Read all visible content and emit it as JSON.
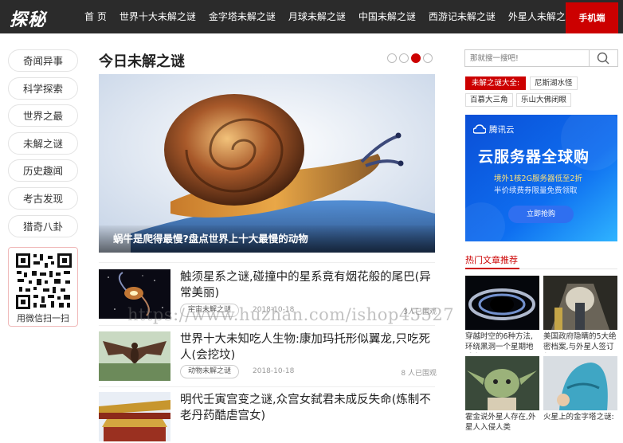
{
  "header": {
    "logo": "探秘",
    "nav": [
      "首 页",
      "世界十大未解之谜",
      "金字塔未解之谜",
      "月球未解之谜",
      "中国未解之谜",
      "西游记未解之谜",
      "外星人未解之谜"
    ],
    "mobile_button": "手机端"
  },
  "left_nav": {
    "items": [
      "奇闻异事",
      "科学探索",
      "世界之最",
      "未解之谜",
      "历史趣闻",
      "考古发现",
      "猎奇八卦"
    ],
    "qr_caption": "用微信扫一扫"
  },
  "main": {
    "title": "今日未解之谜",
    "slider_dots": 4,
    "active_dot": 3,
    "hero_caption": "蜗牛是爬得最慢?盘点世界上十大最慢的动物",
    "articles": [
      {
        "title": "触须星系之谜,碰撞中的星系竟有烟花般的尾巴(异常美丽)",
        "tag": "宇宙未解之谜",
        "date": "2018-10-18",
        "reads": "3人已围观"
      },
      {
        "title": "世界十大未知吃人生物:康加玛托形似翼龙,只吃死人(会挖坟)",
        "tag": "动物未解之谜",
        "date": "2018-10-18",
        "reads": "8 人已围观"
      },
      {
        "title": "明代壬寅宫变之谜,众宫女弑君未成反失命(炼制不老丹药酷虐宫女)"
      }
    ]
  },
  "sidebar": {
    "search_placeholder": "那就搜一搜吧!",
    "hot_label": "未解之谜大全:",
    "keywords": [
      "尼斯湖水怪",
      "百慕大三角",
      "乐山大佛闭眼"
    ],
    "ad": {
      "brand": "腾讯云",
      "title": "云服务器全球购",
      "line1": "境外1核2G服务器低至2折",
      "line2": "半价续费券限量免费领取",
      "button": "立即抢购"
    },
    "recommend_title": "热门文章推荐",
    "recommend": [
      {
        "caption": "穿越时空的6种方法,环绕黑洞一个星期地球竟"
      },
      {
        "caption": "美国政府隐瞒的5大绝密档案,与外星人签订保"
      },
      {
        "caption": "霍金说外星人存在,外星人入侵人类"
      },
      {
        "caption": "火星上的金字塔之谜:"
      }
    ]
  },
  "watermark": "https://www.huzhan.com/ishop45527"
}
